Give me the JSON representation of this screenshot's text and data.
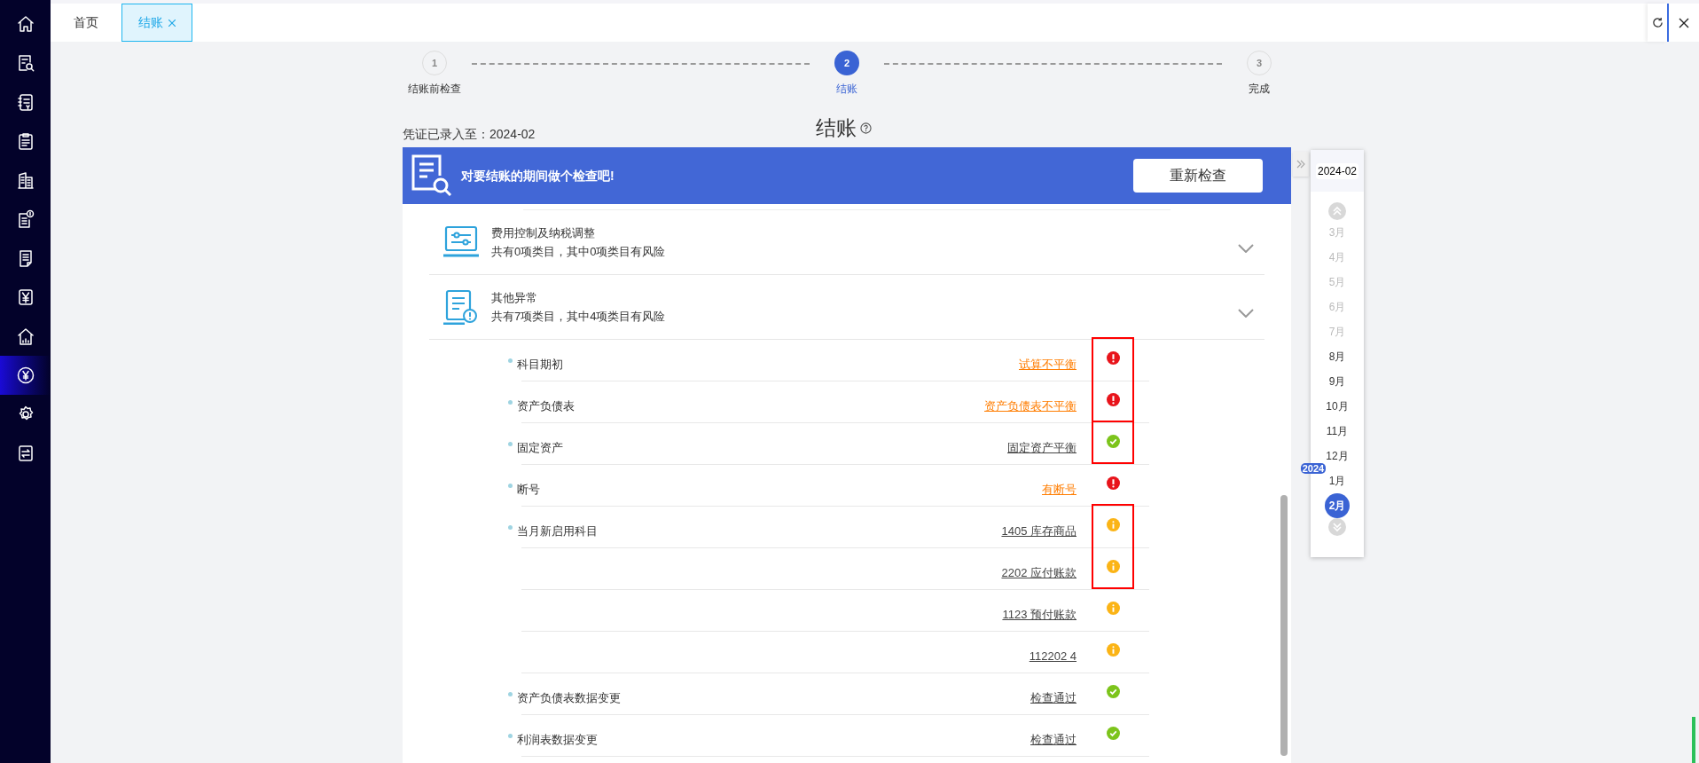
{
  "sidebar": {
    "items": [
      {
        "kind": "home",
        "selected": false
      },
      {
        "kind": "doc-search",
        "selected": false
      },
      {
        "kind": "ledger",
        "selected": false
      },
      {
        "kind": "clipboard",
        "selected": false
      },
      {
        "kind": "buildings",
        "selected": false
      },
      {
        "kind": "doc-coin",
        "selected": false
      },
      {
        "kind": "document",
        "selected": false
      },
      {
        "kind": "yen-box",
        "selected": false
      },
      {
        "kind": "house-chart",
        "selected": false
      },
      {
        "kind": "yen-circle",
        "selected": true
      },
      {
        "kind": "settings",
        "selected": false
      },
      {
        "kind": "transfer",
        "selected": false
      }
    ]
  },
  "tabs": [
    {
      "label": "首页",
      "selected": false,
      "closable": false
    },
    {
      "label": "结账",
      "selected": true,
      "closable": true
    }
  ],
  "steps": [
    {
      "number": "1",
      "label": "结账前检查",
      "selected": false
    },
    {
      "number": "2",
      "label": "结账",
      "selected": true
    },
    {
      "number": "3",
      "label": "完成",
      "selected": false
    }
  ],
  "voucher_status": "凭证已录入至：2024-02",
  "page_title": "结账",
  "banner": {
    "text": "对要结账的期间做个检查吧!",
    "button": "重新检查"
  },
  "sections": [
    {
      "kind": "sliders",
      "title": "费用控制及纳税调整",
      "summary": "共有0项类目，其中0项类目有风险"
    },
    {
      "kind": "alert-doc",
      "title": "其他异常",
      "summary": "共有7项类目，其中4项类目有风险"
    }
  ],
  "check_items": [
    {
      "label": "科目期初",
      "result": "试算不平衡",
      "kind": "error",
      "boxed": true
    },
    {
      "label": "资产负债表",
      "result": "资产负债表不平衡",
      "kind": "error",
      "boxed": true
    },
    {
      "label": "固定资产",
      "result": "固定资产平衡",
      "kind": "ok",
      "boxed": true
    },
    {
      "label": "断号",
      "result": "有断号",
      "kind": "error",
      "boxed": false
    },
    {
      "label": "当月新启用科目",
      "result": "1405 库存商品",
      "kind": "warning",
      "boxed": true
    },
    {
      "result": "2202 应付账款",
      "kind": "warning",
      "boxed": true
    },
    {
      "result": "1123 预付账款",
      "kind": "warning",
      "boxed": false
    },
    {
      "result": "112202 4",
      "kind": "warning",
      "boxed": false
    },
    {
      "label": "资产负债表数据变更",
      "result": "检查通过",
      "kind": "ok",
      "boxed": false
    },
    {
      "label": "利润表数据变更",
      "result": "检查通过",
      "kind": "ok",
      "boxed": false
    }
  ],
  "calendar": {
    "header": "2024-02",
    "months": [
      {
        "label": "3月",
        "disabled": true,
        "selected": false
      },
      {
        "label": "4月",
        "disabled": true,
        "selected": false
      },
      {
        "label": "5月",
        "disabled": true,
        "selected": false
      },
      {
        "label": "6月",
        "disabled": true,
        "selected": false
      },
      {
        "label": "7月",
        "disabled": true,
        "selected": false
      },
      {
        "label": "8月",
        "disabled": false,
        "selected": false
      },
      {
        "label": "9月",
        "disabled": false,
        "selected": false
      },
      {
        "label": "10月",
        "disabled": false,
        "selected": false
      },
      {
        "label": "11月",
        "disabled": false,
        "selected": false
      },
      {
        "label": "12月",
        "disabled": false,
        "selected": false
      },
      {
        "label": "1月",
        "disabled": false,
        "selected": false,
        "year_badge": "2024"
      },
      {
        "label": "2月",
        "disabled": false,
        "selected": true
      }
    ]
  }
}
